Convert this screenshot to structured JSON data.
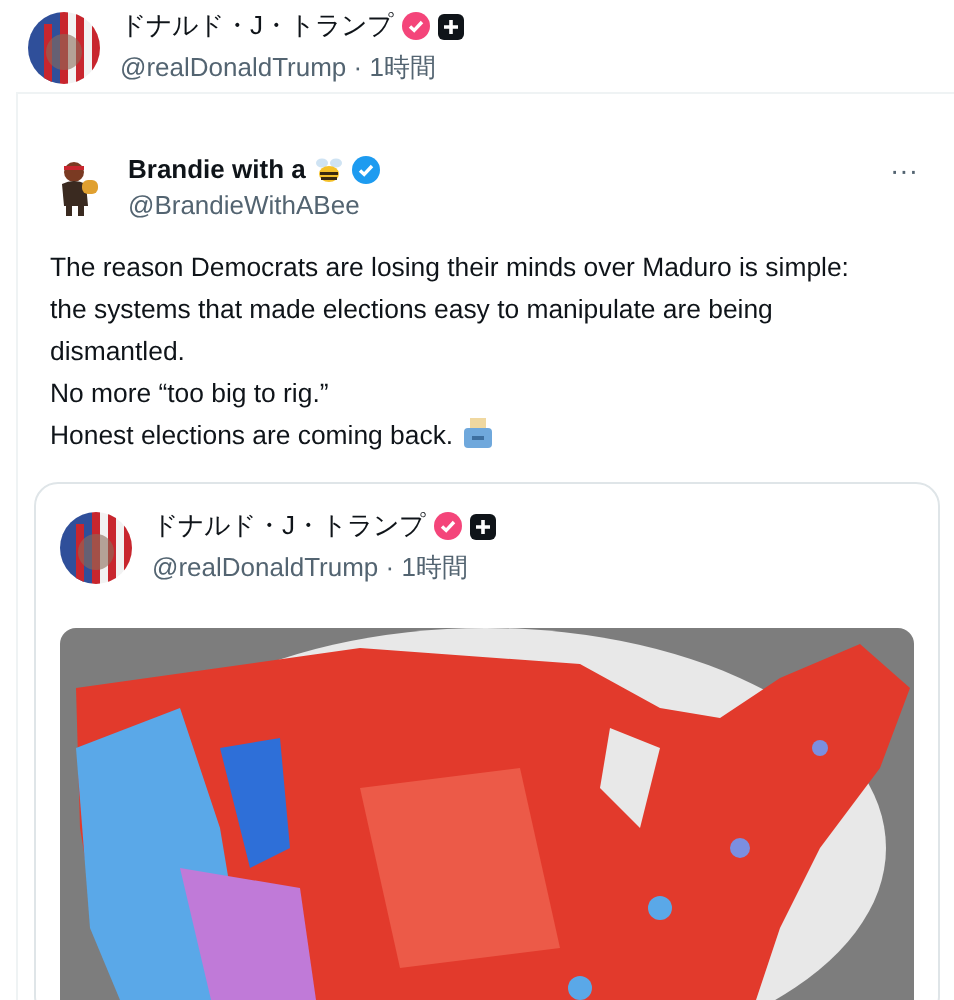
{
  "post": {
    "author": {
      "name": "ドナルド・J・トランプ",
      "meta": "@realDonaldTrump · 1時間",
      "verified": true,
      "subscribe_icon": true
    },
    "quoted_post": {
      "author": {
        "name": "Brandie with a",
        "meta": "@BrandieWithABee",
        "verified": true,
        "subscribe_icon": false
      },
      "more_button": "···",
      "text": "The reason Democrats are losing their minds over Maduro is simple: the systems that made elections easy to manipulate are being dismantled.\nNo more “too big to rig.”\nHonest elections are coming back.",
      "inner_quote": {
        "author": {
          "name": "ドナルド・J・トランプ",
          "meta": "@realDonaldTrump · 1時間",
          "verified": true,
          "subscribe_icon": true
        }
      }
    }
  }
}
